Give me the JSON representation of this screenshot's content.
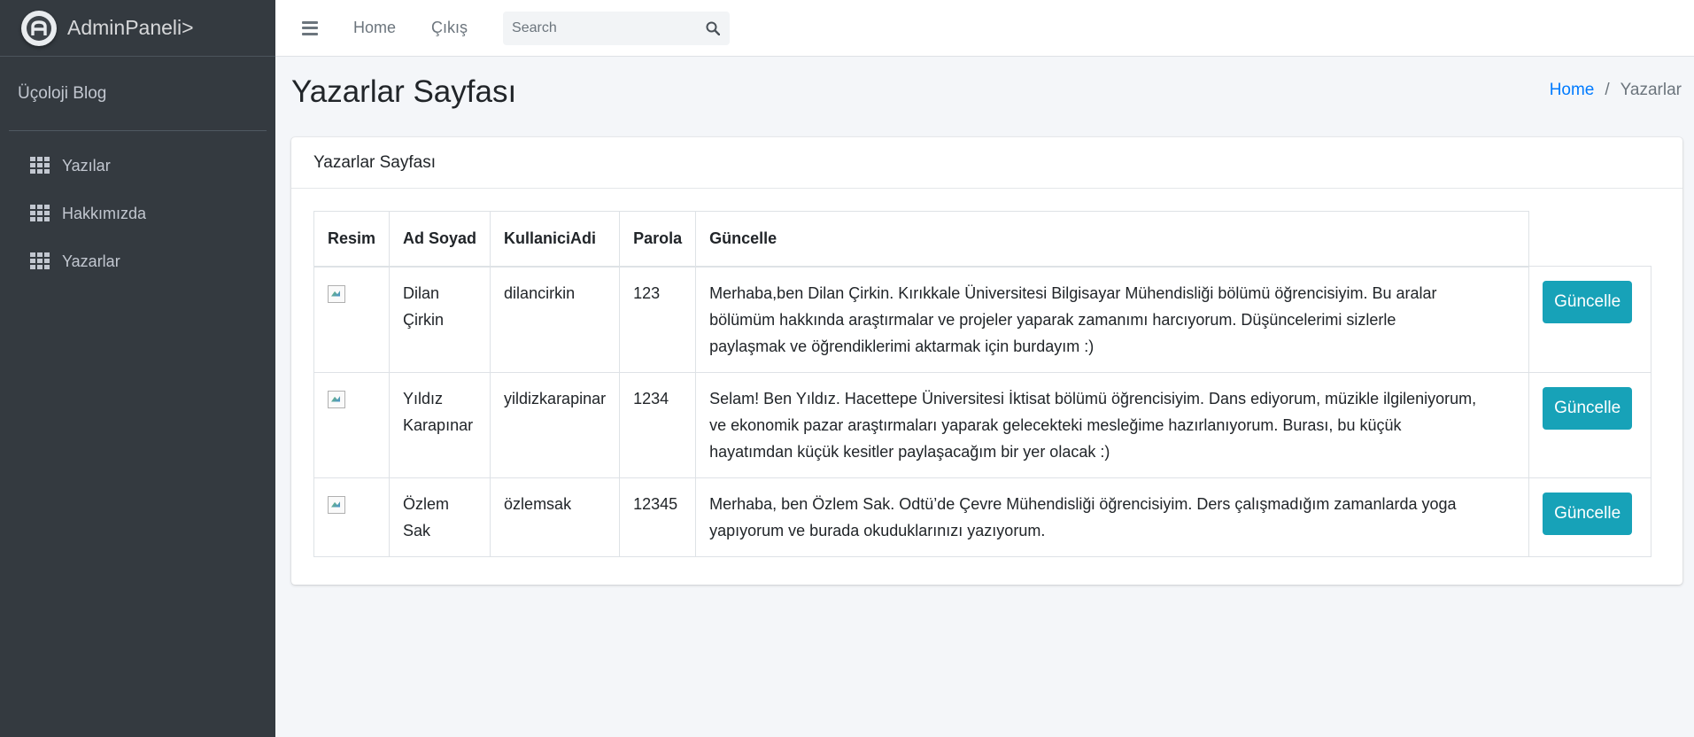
{
  "brand": {
    "title": "AdminPaneli>",
    "logo_letter": "A"
  },
  "sidebar": {
    "user_name": "Üçoloji Blog",
    "items": [
      {
        "label": "Yazılar",
        "icon": "grid-icon"
      },
      {
        "label": "Hakkımızda",
        "icon": "grid-icon"
      },
      {
        "label": "Yazarlar",
        "icon": "grid-icon"
      }
    ]
  },
  "navbar": {
    "home": "Home",
    "logout": "Çıkış",
    "search_placeholder": "Search"
  },
  "page": {
    "title": "Yazarlar Sayfası",
    "breadcrumb": {
      "home": "Home",
      "separator": "/",
      "current": "Yazarlar"
    }
  },
  "card": {
    "title": "Yazarlar Sayfası",
    "columns": [
      "Resim",
      "Ad Soyad",
      "KullaniciAdi",
      "Parola",
      "Güncelle"
    ],
    "rows": [
      {
        "name_first": "Dilan",
        "name_last": "Çirkin",
        "username": "dilancirkin",
        "password": "123",
        "about_lines": [
          "Merhaba,ben Dilan Çirkin. Kırıkkale Üniversitesi Bilgisayar Mühendisliği bölümü öğrencisiyim. Bu aralar",
          "bölümüm hakkında araştırmalar ve projeler yaparak zamanımı harcıyorum. Düşüncelerimi sizlerle",
          "paylaşmak ve öğrendiklerimi aktarmak için burdayım :)"
        ],
        "button": "Güncelle"
      },
      {
        "name_first": "Yıldız",
        "name_last": "Karapınar",
        "username": "yildizkarapinar",
        "password": "1234",
        "about_lines": [
          "Selam! Ben Yıldız. Hacettepe Üniversitesi İktisat bölümü öğrencisiyim. Dans ediyorum, müzikle ilgileniyorum,",
          "ve ekonomik pazar araştırmaları yaparak gelecekteki mesleğime hazırlanıyorum. Burası, bu küçük",
          "hayatımdan küçük kesitler paylaşacağım bir yer olacak :)"
        ],
        "button": "Güncelle"
      },
      {
        "name_first": "Özlem",
        "name_last": "Sak",
        "username": "özlemsak",
        "password": "12345",
        "about_lines": [
          "Merhaba, ben Özlem Sak. Odtü’de Çevre Mühendisliği öğrencisiyim. Ders çalışmadığım zamanlarda yoga",
          "yapıyorum ve burada okuduklarınızı yazıyorum."
        ],
        "button": "Güncelle"
      }
    ]
  },
  "colors": {
    "sidebar_bg": "#343a40",
    "accent": "#17a2b8",
    "link": "#007bff"
  }
}
